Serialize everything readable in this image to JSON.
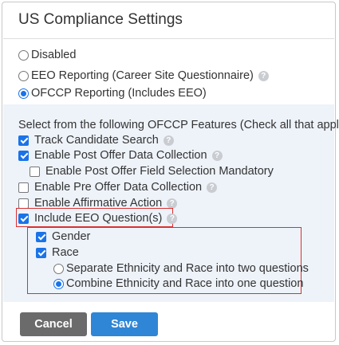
{
  "header": {
    "title": "US Compliance Settings"
  },
  "mode": {
    "options": [
      {
        "label": "Disabled",
        "selected": false,
        "help": false
      },
      {
        "label": "EEO Reporting (Career Site Questionnaire)",
        "selected": false,
        "help": true
      },
      {
        "label": "OFCCP Reporting (Includes EEO)",
        "selected": true,
        "help": false
      }
    ]
  },
  "features": {
    "instruction": "Select from the following OFCCP Features (Check all that apply)",
    "items": [
      {
        "label": "Track Candidate Search",
        "checked": true,
        "help": true
      },
      {
        "label": "Enable Post Offer Data Collection",
        "checked": true,
        "help": true
      },
      {
        "label": "Enable Post Offer Field Selection Mandatory",
        "checked": false,
        "help": false
      },
      {
        "label": "Enable Pre Offer Data Collection",
        "checked": false,
        "help": true
      },
      {
        "label": "Enable Affirmative Action",
        "checked": false,
        "help": true
      },
      {
        "label": "Include EEO Question(s)",
        "checked": true,
        "help": true
      }
    ]
  },
  "eeo_questions": {
    "gender": {
      "label": "Gender",
      "checked": true
    },
    "race": {
      "label": "Race",
      "checked": true
    },
    "race_options": [
      {
        "label": "Separate Ethnicity and Race into two questions",
        "selected": false
      },
      {
        "label": "Combine Ethnicity and Race into one question",
        "selected": true
      }
    ]
  },
  "help_glyph": "?",
  "buttons": {
    "cancel": "Cancel",
    "save": "Save"
  },
  "colors": {
    "accent": "#1a73e8",
    "highlight_border": "#d9302f",
    "features_bg": "#eef3fa",
    "cancel_bg": "#6b6b6b",
    "save_bg": "#2f86d6"
  }
}
